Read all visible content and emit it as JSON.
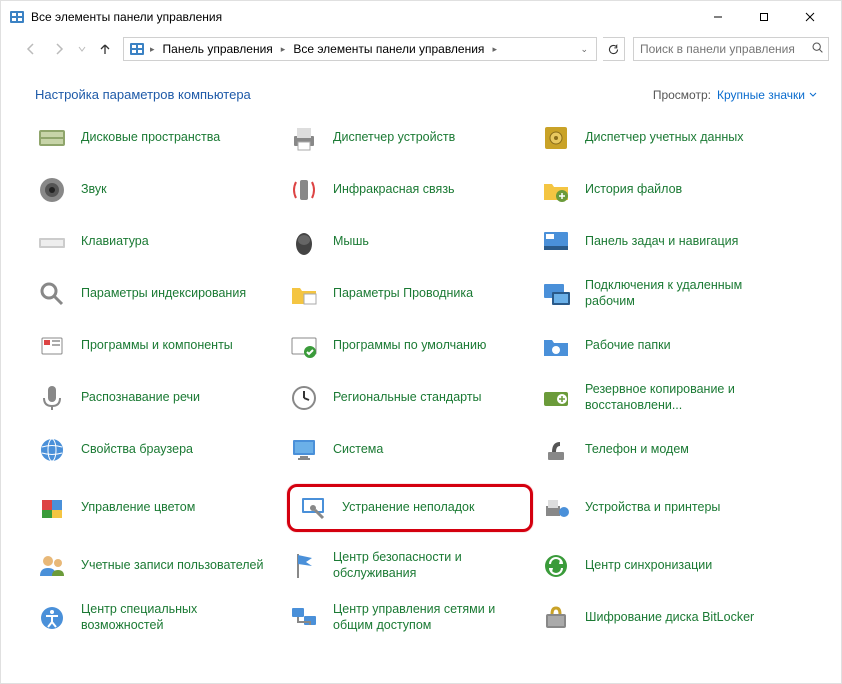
{
  "titlebar": {
    "title": "Все элементы панели управления"
  },
  "nav": {
    "crumb1": "Панель управления",
    "crumb2": "Все элементы панели управления",
    "searchPlaceholder": "Поиск в панели управления"
  },
  "header": {
    "title": "Настройка параметров компьютера",
    "viewLabel": "Просмотр:",
    "viewValue": "Крупные значки"
  },
  "items": [
    {
      "name": "storage-spaces",
      "label": "Дисковые пространства",
      "icon": "storage"
    },
    {
      "name": "device-manager",
      "label": "Диспетчер устройств",
      "icon": "printer"
    },
    {
      "name": "credential-manager",
      "label": "Диспетчер учетных данных",
      "icon": "vault"
    },
    {
      "name": "sound",
      "label": "Звук",
      "icon": "speaker"
    },
    {
      "name": "infrared",
      "label": "Инфракрасная связь",
      "icon": "ir"
    },
    {
      "name": "file-history",
      "label": "История файлов",
      "icon": "folder"
    },
    {
      "name": "keyboard",
      "label": "Клавиатура",
      "icon": "keyboard"
    },
    {
      "name": "mouse",
      "label": "Мышь",
      "icon": "mouse"
    },
    {
      "name": "taskbar-navigation",
      "label": "Панель задач и навигация",
      "icon": "taskbar"
    },
    {
      "name": "indexing-options",
      "label": "Параметры индексирования",
      "icon": "index"
    },
    {
      "name": "explorer-options",
      "label": "Параметры Проводника",
      "icon": "folderopt"
    },
    {
      "name": "remote-desktop",
      "label": "Подключения к удаленным рабочим",
      "icon": "remote"
    },
    {
      "name": "programs-features",
      "label": "Программы и компоненты",
      "icon": "programs"
    },
    {
      "name": "default-programs",
      "label": "Программы по умолчанию",
      "icon": "defaults"
    },
    {
      "name": "work-folders",
      "label": "Рабочие папки",
      "icon": "workfolders"
    },
    {
      "name": "speech-recognition",
      "label": "Распознавание речи",
      "icon": "mic"
    },
    {
      "name": "region",
      "label": "Региональные стандарты",
      "icon": "clock"
    },
    {
      "name": "backup-restore",
      "label": "Резервное копирование и восстановлени...",
      "icon": "backup"
    },
    {
      "name": "internet-options",
      "label": "Свойства браузера",
      "icon": "internet"
    },
    {
      "name": "system",
      "label": "Система",
      "icon": "system"
    },
    {
      "name": "phone-modem",
      "label": "Телефон и модем",
      "icon": "phone"
    },
    {
      "name": "color-management",
      "label": "Управление цветом",
      "icon": "color"
    },
    {
      "name": "troubleshooting",
      "label": "Устранение неполадок",
      "icon": "troubleshoot",
      "highlight": true
    },
    {
      "name": "devices-printers",
      "label": "Устройства и принтеры",
      "icon": "devprint"
    },
    {
      "name": "user-accounts",
      "label": "Учетные записи пользователей",
      "icon": "users"
    },
    {
      "name": "security-maintenance",
      "label": "Центр безопасности и обслуживания",
      "icon": "flag"
    },
    {
      "name": "sync-center",
      "label": "Центр синхронизации",
      "icon": "sync"
    },
    {
      "name": "ease-of-access",
      "label": "Центр специальных возможностей",
      "icon": "ease"
    },
    {
      "name": "network-sharing",
      "label": "Центр управления сетями и общим доступом",
      "icon": "network"
    },
    {
      "name": "bitlocker",
      "label": "Шифрование диска BitLocker",
      "icon": "bitlocker"
    }
  ]
}
